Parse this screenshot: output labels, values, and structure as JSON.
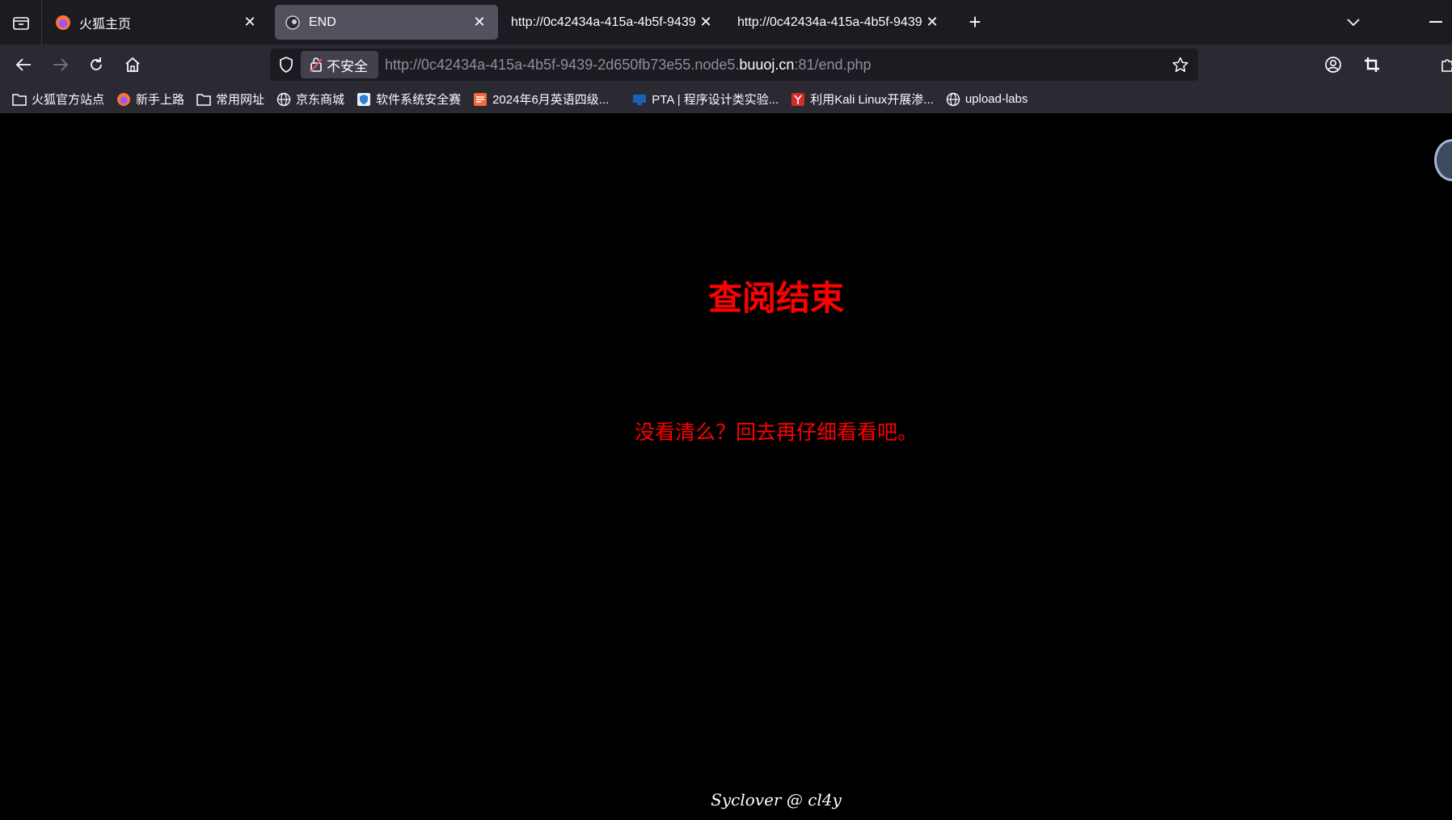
{
  "tabs": [
    {
      "title": "火狐主页",
      "icon": "firefox-icon",
      "active": false
    },
    {
      "title": "END",
      "icon": "site-icon",
      "active": true
    },
    {
      "title": "http://0c42434a-415a-4b5f-9439",
      "icon": "",
      "active": false
    },
    {
      "title": "http://0c42434a-415a-4b5f-9439",
      "icon": "",
      "active": false
    }
  ],
  "nav": {
    "security_label": "不安全",
    "url_prefix": "http://0c42434a-415a-4b5f-9439-2d650fb73e55.node5.",
    "url_host": "buuoj.cn",
    "url_suffix": ":81/end.php"
  },
  "bookmarks": [
    {
      "label": "火狐官方站点",
      "icon": "folder-icon"
    },
    {
      "label": "新手上路",
      "icon": "firefox-icon"
    },
    {
      "label": "常用网址",
      "icon": "folder-icon"
    },
    {
      "label": "京东商城",
      "icon": "globe-icon"
    },
    {
      "label": "软件系统安全赛",
      "icon": "shield-badge-icon"
    },
    {
      "label": "2024年6月英语四级...",
      "icon": "document-icon"
    },
    {
      "label": "PTA | 程序设计类实验...",
      "icon": "pta-icon"
    },
    {
      "label": "利用Kali Linux开展渗...",
      "icon": "kali-icon"
    },
    {
      "label": "upload-labs",
      "icon": "globe-icon"
    }
  ],
  "page": {
    "headline": "查阅结束",
    "subline": "没看清么？回去再仔细看看吧。",
    "footer": "Syclover @ cl4y"
  },
  "colors": {
    "page_text": "#ff0000",
    "page_bg": "#000000",
    "chrome_bg": "#2b2a33",
    "tabstrip_bg": "#1c1b22"
  }
}
